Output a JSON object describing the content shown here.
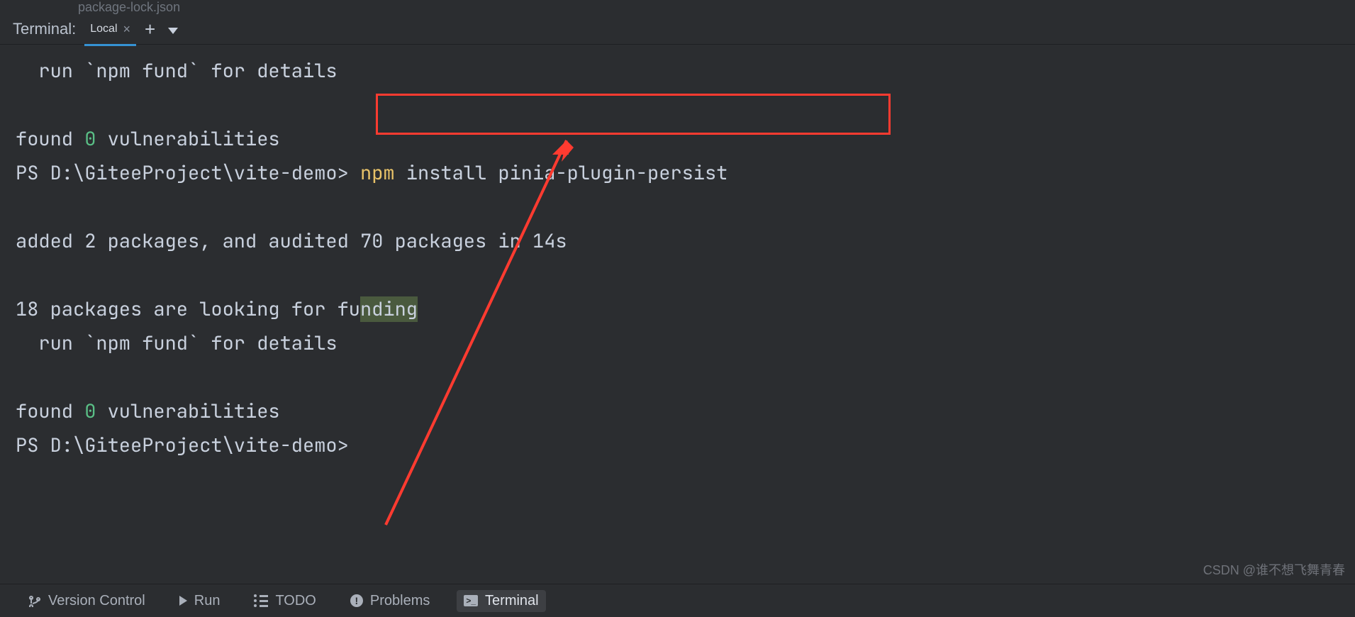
{
  "top_clip": "package-lock.json",
  "tabs_title": "Terminal:",
  "tabs_active": "Local",
  "terminal_output": {
    "line1_indent": "  run `npm fund` for details",
    "line2": "",
    "vuln1_a": "found ",
    "vuln1_num": "0",
    "vuln1_b": " vulnerabilities",
    "prompt1": "PS D:\\GiteeProject\\vite-demo> ",
    "cmd_npm": "npm",
    "cmd_rest": " install pinia-plugin-persist",
    "blank2": "",
    "added": "added 2 packages, and audited 70 packages in 14s",
    "blank3": "",
    "look_a": "18 packages are looking for fu",
    "look_hl": "nding",
    "line4_indent": "  run `npm fund` for details",
    "blank4": "",
    "vuln2_a": "found ",
    "vuln2_num": "0",
    "vuln2_b": " vulnerabilities",
    "prompt2": "PS D:\\GiteeProject\\vite-demo>"
  },
  "bottom_tabs": {
    "version_control": "Version Control",
    "run": "Run",
    "todo": "TODO",
    "problems": "Problems",
    "terminal": "Terminal"
  },
  "watermark": "CSDN @谁不想飞舞青春"
}
